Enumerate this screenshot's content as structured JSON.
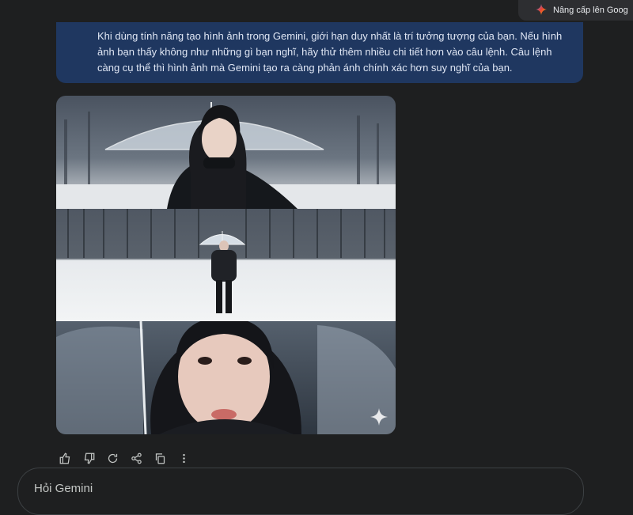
{
  "header": {
    "upgrade_label": "Nâng cấp lên Goog",
    "upgrade_icon": "gemini-sparkle-icon"
  },
  "banner": {
    "lines": [
      "Khi dùng tính năng tạo hình ảnh trong Gemini, giới hạn duy nhất là trí tưởng tượng của bạn. Nếu hình",
      "ảnh bạn thấy không như những gì bạn nghĩ, hãy thử thêm nhiều chi tiết hơn vào câu lệnh. Câu lệnh",
      "càng cụ thể thì hình ảnh mà Gemini tạo ra càng phản ánh chính xác hơn suy nghĩ của bạn."
    ]
  },
  "images": [
    {
      "subject": "woman-with-clear-umbrella-in-snow-closeup"
    },
    {
      "subject": "woman-with-umbrella-standing-in-snowy-field"
    },
    {
      "subject": "woman-face-closeup-under-umbrella"
    }
  ],
  "actions": [
    "thumbs-up-icon",
    "thumbs-down-icon",
    "regenerate-icon",
    "share-icon",
    "copy-icon",
    "more-vert-icon"
  ],
  "prompt": {
    "placeholder": "Hỏi Gemini"
  },
  "colors": {
    "background": "#1e1f20",
    "banner": "#1f3760",
    "upgrade_chip": "#2d2e31"
  }
}
